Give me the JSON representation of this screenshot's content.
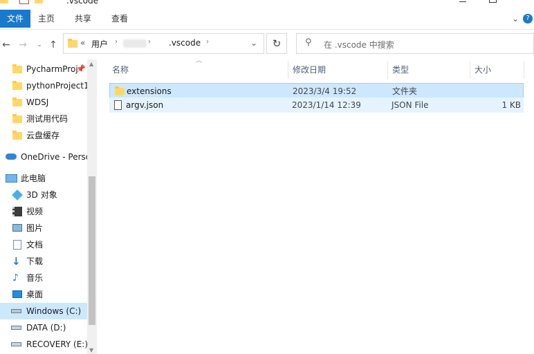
{
  "window": {
    "title": ".vscode"
  },
  "ribbon": {
    "tabs": [
      "文件",
      "主页",
      "共享",
      "查看"
    ]
  },
  "address": {
    "path_prefix": "«",
    "segments": [
      "用户",
      "",
      ".vscode"
    ]
  },
  "search": {
    "placeholder": "在 .vscode 中搜索"
  },
  "sidebar": {
    "items": [
      {
        "label": "PycharmProj",
        "icon": "folder-icon"
      },
      {
        "label": "pythonProject1",
        "icon": "folder-icon"
      },
      {
        "label": "WDSJ",
        "icon": "folder-icon"
      },
      {
        "label": "测试用代码",
        "icon": "folder-icon"
      },
      {
        "label": "云盘缓存",
        "icon": "folder-icon"
      },
      {
        "label": "OneDrive - Perso",
        "icon": "cloud-icon"
      },
      {
        "label": "此电脑",
        "icon": "computer-icon"
      },
      {
        "label": "3D 对象",
        "icon": "cube-icon"
      },
      {
        "label": "视频",
        "icon": "video-icon"
      },
      {
        "label": "图片",
        "icon": "picture-icon"
      },
      {
        "label": "文档",
        "icon": "document-icon"
      },
      {
        "label": "下载",
        "icon": "download-icon"
      },
      {
        "label": "音乐",
        "icon": "music-icon"
      },
      {
        "label": "桌面",
        "icon": "desktop-icon"
      },
      {
        "label": "Windows (C:)",
        "icon": "drive-icon"
      },
      {
        "label": "DATA (D:)",
        "icon": "drive-icon"
      },
      {
        "label": "RECOVERY (E:)",
        "icon": "drive-icon"
      }
    ]
  },
  "columns": [
    "名称",
    "修改日期",
    "类型",
    "大小"
  ],
  "files": [
    {
      "name": "extensions",
      "modified": "2023/3/4 19:52",
      "type": "文件夹",
      "size": "",
      "icon": "folder-icon"
    },
    {
      "name": "argv.json",
      "modified": "2023/1/14 12:39",
      "type": "JSON File",
      "size": "1 KB",
      "icon": "json-file-icon"
    }
  ]
}
